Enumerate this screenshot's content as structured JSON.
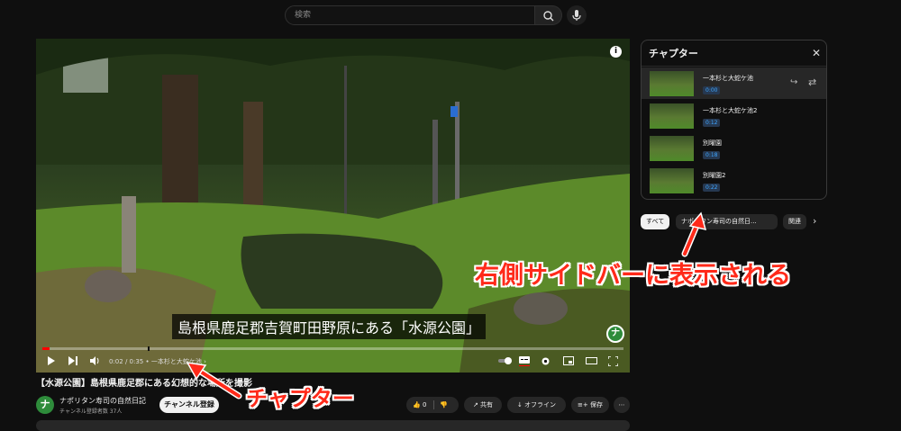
{
  "search": {
    "placeholder": "検索"
  },
  "player": {
    "caption": "島根県鹿足郡吉賀町田野原にある「水源公園」",
    "time": "0:02 / 0:35",
    "chapter_name": "一本杉と大蛇ケ池",
    "progress_fraction": 0.013,
    "badge": "ナ",
    "info": "i"
  },
  "video": {
    "title": "【水源公園】島根県鹿足郡にある幻想的な場所を撮影",
    "channel_name": "ナポリタン寿司の自然日記",
    "channel_subs": "チャンネル登録者数 37人",
    "avatar_letter": "ナ",
    "subscribe_label": "チャンネル登録",
    "like_count": "0",
    "share_label": "共有",
    "offline_label": "オフライン",
    "save_label": "保存"
  },
  "chapters": {
    "title": "チャプター",
    "items": [
      {
        "label": "一本杉と大蛇ケ池",
        "time": "0:00"
      },
      {
        "label": "一本杉と大蛇ケ池2",
        "time": "0:12"
      },
      {
        "label": "別曜園",
        "time": "0:18"
      },
      {
        "label": "別曜園2",
        "time": "0:22"
      }
    ]
  },
  "chips": [
    "すべて",
    "ナポリタン寿司の自然日...",
    "関連"
  ],
  "annotations": {
    "right_sidebar": "右側サイドバーに表示される",
    "chapter": "チャプター"
  },
  "colors": {
    "accent_red": "#ff0000",
    "annotation_red": "#ff2a1a",
    "link_blue": "#3ea6ff"
  }
}
